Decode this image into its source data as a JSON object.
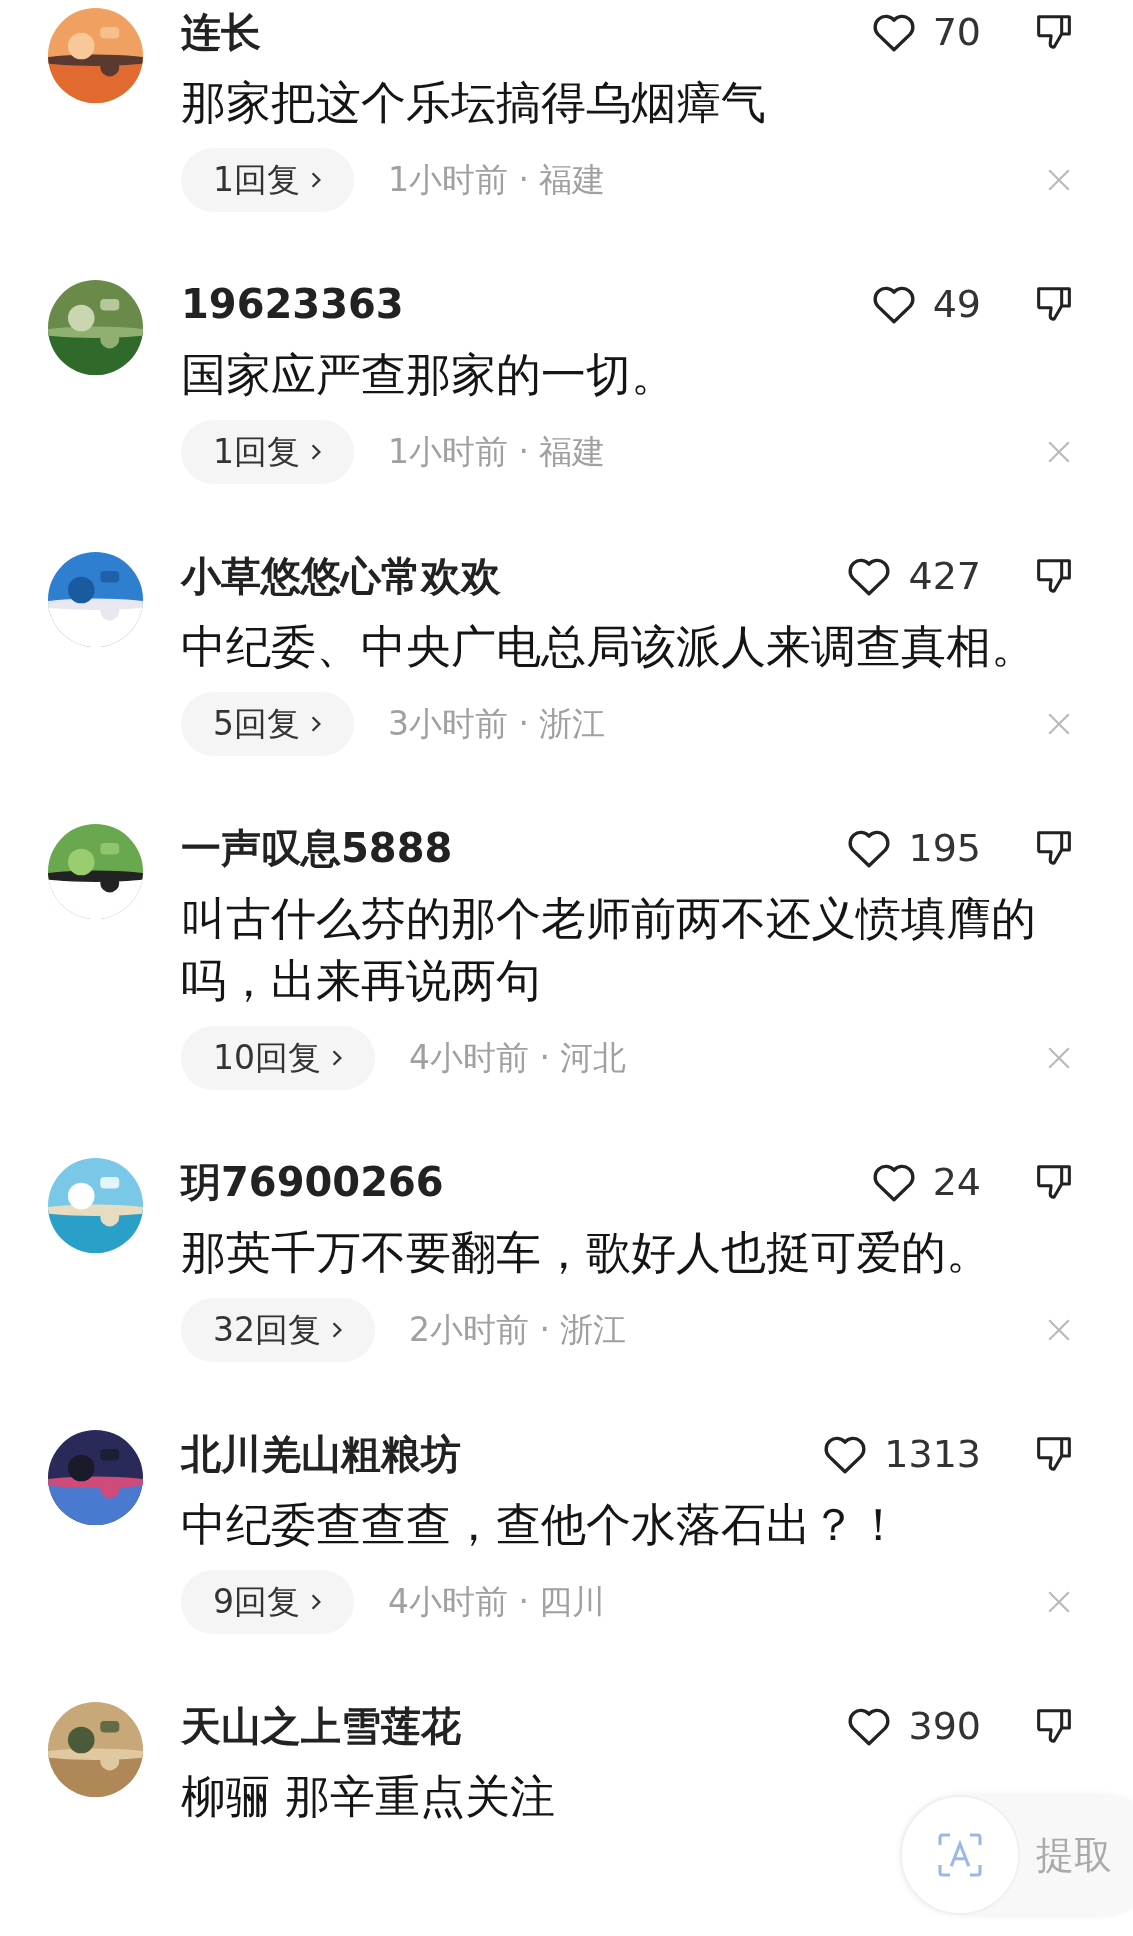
{
  "comments": [
    {
      "name": "连长",
      "likes": "70",
      "text": "那家把这个乐坛搞得乌烟瘴气",
      "replies": "1回复",
      "meta": "1小时前 · 福建"
    },
    {
      "name": "19623363",
      "likes": "49",
      "text": "国家应严查那家的一切。",
      "replies": "1回复",
      "meta": "1小时前 · 福建"
    },
    {
      "name": "小草悠悠心常欢欢",
      "likes": "427",
      "text": "中纪委、中央广电总局该派人来调查真相。",
      "replies": "5回复",
      "meta": "3小时前 · 浙江"
    },
    {
      "name": "一声叹息5888",
      "likes": "195",
      "text": "叫古什么芬的那个老师前两不还义愤填膺的吗，出来再说两句",
      "replies": "10回复",
      "meta": "4小时前 · 河北"
    },
    {
      "name": "玥76900266",
      "likes": "24",
      "text": "那英千万不要翻车，歌好人也挺可爱的。",
      "replies": "32回复",
      "meta": "2小时前 · 浙江"
    },
    {
      "name": "北川羌山粗粮坊",
      "likes": "1313",
      "text": "中纪委查查查，查他个水落石出？！",
      "replies": "9回复",
      "meta": "4小时前 · 四川"
    },
    {
      "name": "天山之上雪莲花",
      "likes": "390",
      "text": "柳骊 那辛重点关注"
    }
  ],
  "extract_button": {
    "label": "提取"
  }
}
